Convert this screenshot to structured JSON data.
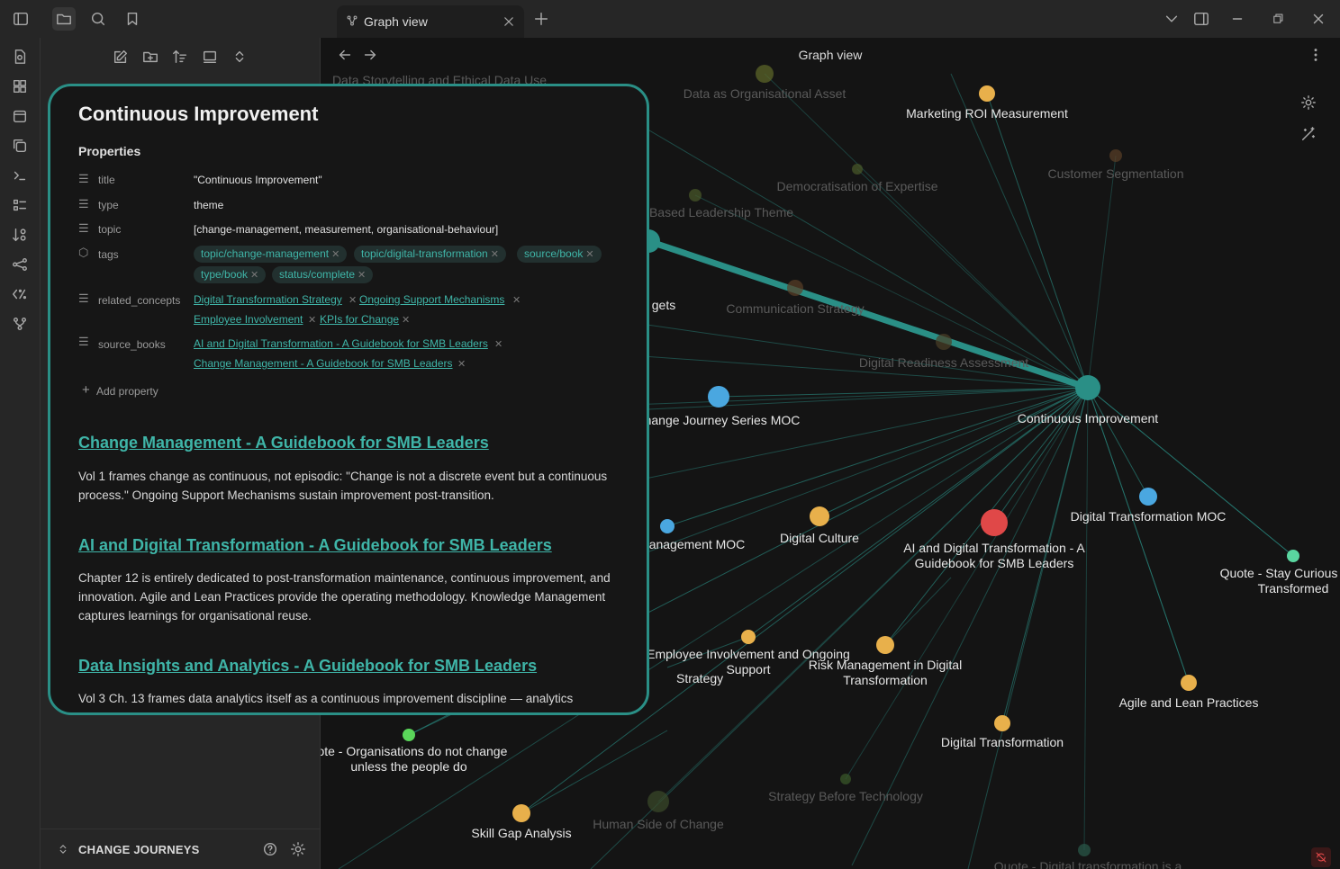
{
  "tab": {
    "title": "Graph view"
  },
  "graph": {
    "header_title": "Graph view",
    "center": "Continuous Improvement",
    "nodes": [
      {
        "label": "Marketing ROI Measurement",
        "color": "#e8b04b"
      },
      {
        "label": "Data as Organisational Asset",
        "color": "#5f6a2a"
      },
      {
        "label": "Customer Segmentation",
        "color": "#5a3f26"
      },
      {
        "label": "Democratisation of Expertise",
        "color": "#4a5a2a"
      },
      {
        "label": "Based Leadership Theme",
        "color": "#4a5a2a"
      },
      {
        "label": "Communication Strategy",
        "color": "#5a3f26"
      },
      {
        "label": "Digital Readiness Assessment",
        "color": "#4a3f26"
      },
      {
        "label": "gets",
        "color": "#2a8f86"
      },
      {
        "label": "hange Journey Series MOC",
        "color": "#4aa7e0"
      },
      {
        "label": "Continuous Improvement",
        "color": "#2a8f86"
      },
      {
        "label": "Digital Transformation MOC",
        "color": "#4aa7e0"
      },
      {
        "label": "anagement MOC",
        "color": "#4aa7e0"
      },
      {
        "label": "Digital Culture",
        "color": "#e8b04b"
      },
      {
        "label": "AI and Digital Transformation - A Guidebook for SMB Leaders",
        "color": "#e04848"
      },
      {
        "label": "Quote - Stay Curious Stay Transformed",
        "color": "#5ad6a0"
      },
      {
        "label": "Employee Involvement and Ongoing Support",
        "color": "#e8b04b"
      },
      {
        "label": "Risk Management in Digital Transformation",
        "color": "#e8b04b"
      },
      {
        "label": "Agile and Lean Practices",
        "color": "#e8b04b"
      },
      {
        "label": "Digital Transformation",
        "color": "#e8b04b"
      },
      {
        "label": "uote - Organisations do not change unless the people do",
        "color": "#5ad65a"
      },
      {
        "label": "Strategy Before Technology",
        "color": "#3a5a2a"
      },
      {
        "label": "Skill Gap Analysis",
        "color": "#e8b04b"
      },
      {
        "label": "Human Side of Change",
        "color": "#3a4a2a"
      },
      {
        "label": "Quote - Digital transformation is a",
        "color": "#2a5a4a"
      },
      {
        "label": "Data Storytelling and Ethical Data Use",
        "color": "#3a3a3a"
      },
      {
        "label": "Strategy",
        "color": "#3a3a3a"
      }
    ]
  },
  "popover": {
    "title": "Continuous Improvement",
    "properties_heading": "Properties",
    "props": {
      "title_key": "title",
      "title_val": "\"Continuous Improvement\"",
      "type_key": "type",
      "type_val": "theme",
      "topic_key": "topic",
      "topic_val": "[change-management, measurement, organisational-behaviour]",
      "tags_key": "tags",
      "tags": [
        "topic/change-management",
        "topic/digital-transformation",
        "source/book",
        "type/book",
        "status/complete"
      ],
      "related_key": "related_concepts",
      "related": [
        "Digital Transformation Strategy",
        "Ongoing Support Mechanisms",
        "Employee Involvement",
        "KPIs for Change"
      ],
      "source_key": "source_books",
      "sources": [
        "AI and Digital Transformation - A Guidebook for SMB Leaders",
        "Change Management - A Guidebook for SMB Leaders"
      ],
      "add": "Add property"
    },
    "sections": [
      {
        "title": "Change Management - A Guidebook for SMB Leaders",
        "body": "Vol 1 frames change as continuous, not episodic: \"Change is not a discrete event but a continuous process.\" Ongoing Support Mechanisms sustain improvement post-transition."
      },
      {
        "title": "AI and Digital Transformation - A Guidebook for SMB Leaders",
        "body": "Chapter 12 is entirely dedicated to post-transformation maintenance, continuous improvement, and innovation. Agile and Lean Practices provide the operating methodology. Knowledge Management captures learnings for organisational reuse."
      },
      {
        "title": "Data Insights and Analytics - A Guidebook for SMB Leaders",
        "body": "Vol 3 Ch. 13 frames data analytics itself as a continuous improvement discipline — analytics"
      }
    ]
  },
  "sidebar": {
    "vault_name": "CHANGE JOURNEYS"
  }
}
